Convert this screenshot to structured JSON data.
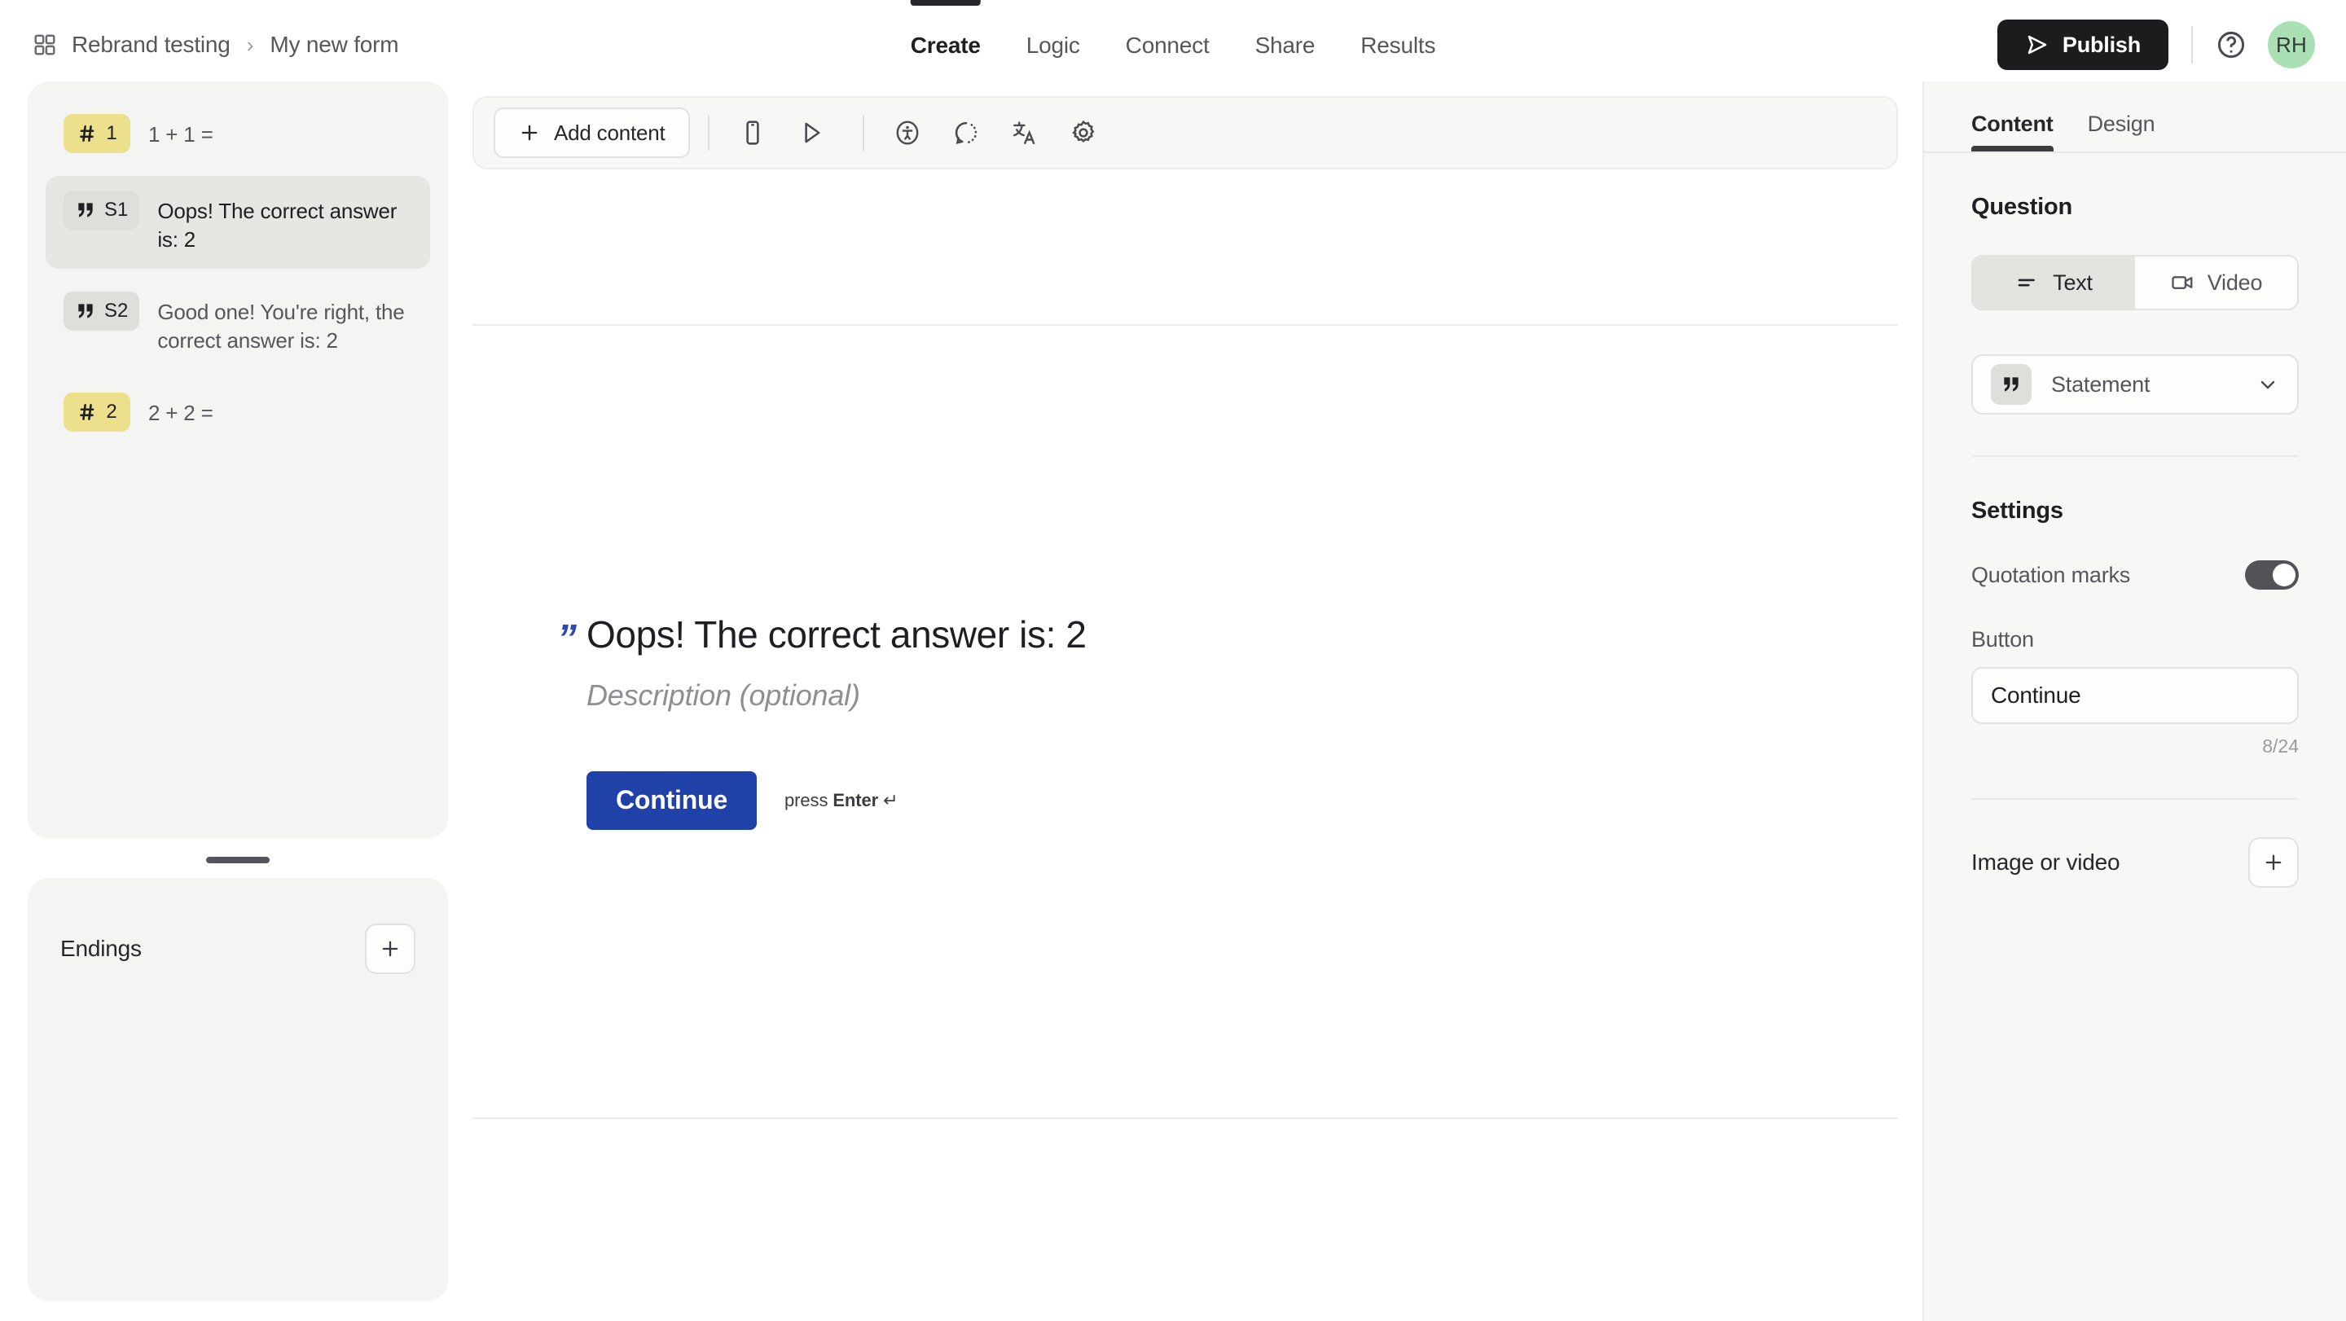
{
  "header": {
    "workspace_icon": "grid-icon",
    "workspace": "Rebrand testing",
    "separator": "›",
    "form_name": "My new form",
    "tabs": [
      {
        "label": "Create",
        "active": true
      },
      {
        "label": "Logic",
        "active": false
      },
      {
        "label": "Connect",
        "active": false
      },
      {
        "label": "Share",
        "active": false
      },
      {
        "label": "Results",
        "active": false
      }
    ],
    "publish_label": "Publish",
    "publish_icon": "send-icon",
    "help_icon": "help-circle-icon",
    "avatar_initials": "RH",
    "avatar_color": "#abe0b4",
    "publish_bg": "#1c1c1e"
  },
  "sidebar": {
    "questions": [
      {
        "badge_icon": "hash-icon",
        "badge_label": "1",
        "badge_type": "num",
        "text": "1 + 1 =",
        "selected": false
      },
      {
        "badge_icon": "quote-icon",
        "badge_label": "S1",
        "badge_type": "stmt",
        "text": "Oops! The correct answer is: 2",
        "selected": true
      },
      {
        "badge_icon": "quote-icon",
        "badge_label": "S2",
        "badge_type": "stmt",
        "text": "Good one! You're right, the correct answer is: 2",
        "selected": false
      },
      {
        "badge_icon": "hash-icon",
        "badge_label": "2",
        "badge_type": "num",
        "text": "2 + 2 =",
        "selected": false
      }
    ],
    "endings_title": "Endings",
    "endings_add_icon": "plus-icon",
    "badge_num_color": "#ece08c",
    "badge_stmt_color": "#dededa"
  },
  "toolbar": {
    "add_content_label": "Add content",
    "add_content_icon": "plus-icon",
    "icons": [
      {
        "name": "mobile-preview-icon"
      },
      {
        "name": "play-preview-icon"
      },
      {
        "name": "accessibility-icon"
      },
      {
        "name": "reset-icon"
      },
      {
        "name": "translate-icon"
      },
      {
        "name": "settings-gear-icon"
      }
    ]
  },
  "canvas": {
    "quote_mark": "”",
    "quote_color": "#2a48b5",
    "headline": "Oops! The correct answer is: 2",
    "description_placeholder": "Description (optional)",
    "continue_label": "Continue",
    "continue_color": "#1f41a8",
    "enter_hint_prefix": "press ",
    "enter_hint_key": "Enter",
    "enter_hint_glyph": "↵"
  },
  "rightpanel": {
    "tabs": [
      {
        "label": "Content",
        "active": true
      },
      {
        "label": "Design",
        "active": false
      }
    ],
    "question_section_title": "Question",
    "media_toggle": [
      {
        "label": "Text",
        "icon": "text-align-icon",
        "active": true
      },
      {
        "label": "Video",
        "icon": "video-camera-icon",
        "active": false
      }
    ],
    "type_icon": "quote-icon",
    "type_label": "Statement",
    "type_chevron": "chevron-down-icon",
    "settings_title": "Settings",
    "quotation_marks_label": "Quotation marks",
    "quotation_marks_on": true,
    "button_label": "Button",
    "button_value": "Continue",
    "button_char_count": "8/24",
    "media_label": "Image or video",
    "media_add_icon": "plus-icon"
  }
}
